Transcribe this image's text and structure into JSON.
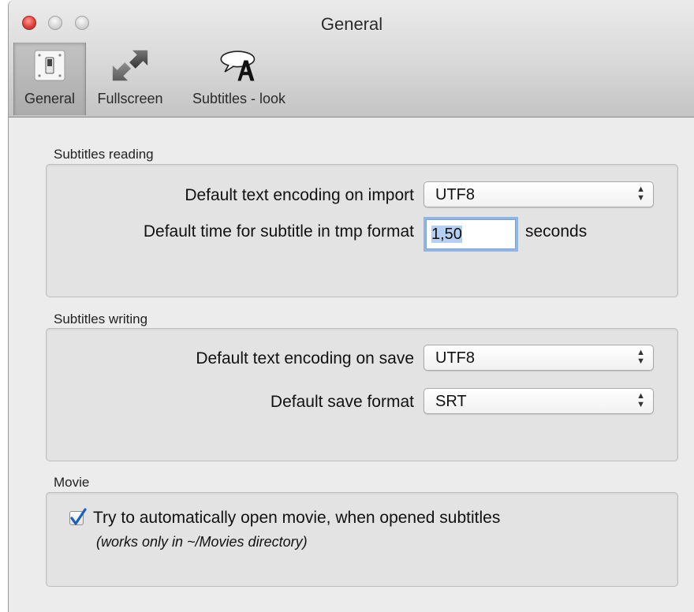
{
  "window": {
    "title": "General"
  },
  "toolbar": {
    "items": [
      {
        "label": "General",
        "icon": "light-switch-icon",
        "active": true
      },
      {
        "label": "Fullscreen",
        "icon": "expand-arrows-icon",
        "active": false
      },
      {
        "label": "Subtitles - look",
        "icon": "speech-bubble-letter-icon",
        "active": false
      }
    ]
  },
  "subtitles_reading": {
    "title": "Subtitles reading",
    "encoding_label": "Default text encoding on import",
    "encoding_value": "UTF8",
    "time_label": "Default time for subtitle in tmp format",
    "time_value": "1,50",
    "time_unit": "seconds"
  },
  "subtitles_writing": {
    "title": "Subtitles writing",
    "encoding_label": "Default text encoding on save",
    "encoding_value": "UTF8",
    "format_label": "Default save format",
    "format_value": "SRT"
  },
  "movie": {
    "title": "Movie",
    "auto_open_label": "Try to automatically open movie, when opened subtitles",
    "auto_open_checked": true,
    "note": "(works only in ~/Movies directory)"
  },
  "colors": {
    "focus_ring": "#8fb5e9",
    "close_button": "#e0413c",
    "checkmark": "#1f5fb8"
  }
}
